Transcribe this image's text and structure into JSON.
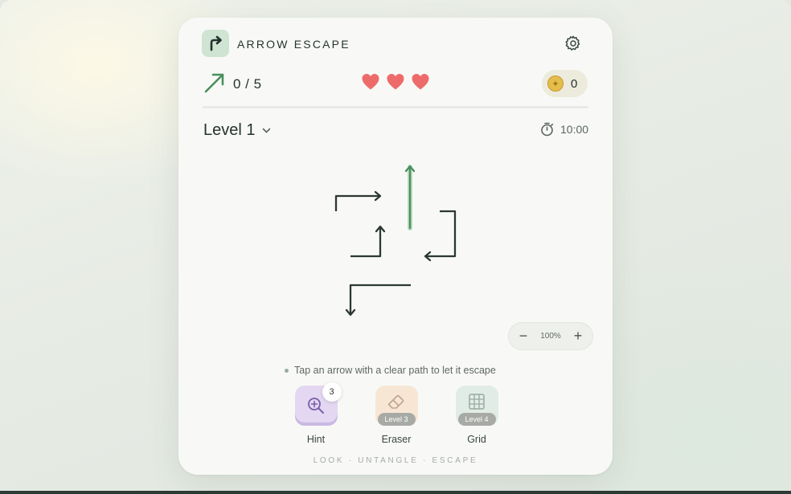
{
  "app": {
    "title": "ARROW ESCAPE"
  },
  "stats": {
    "progress": "0 / 5",
    "lives": 3,
    "coins": "0"
  },
  "level": {
    "label": "Level 1",
    "timer": "10:00"
  },
  "zoom": {
    "level": "100%",
    "minus": "−",
    "plus": "+"
  },
  "hint_text": "Tap an arrow with a clear path to let it escape",
  "tools": {
    "hint": {
      "label": "Hint",
      "count": "3"
    },
    "eraser": {
      "label": "Eraser",
      "lock": "Level 3"
    },
    "grid": {
      "label": "Grid",
      "lock": "Level 4"
    }
  },
  "footer": {
    "tagline": "LOOK · UNTANGLE · ESCAPE"
  },
  "colors": {
    "accent_green": "#4a8f5e",
    "heart_red": "#ee6b6b",
    "arrow_dark": "#2c3833",
    "coin_gold": "#e5bd4c"
  },
  "icons": [
    "turn-right-arrow-logo-icon",
    "gear-icon",
    "trend-arrow-icon",
    "heart-icon",
    "coin-icon",
    "chevron-down-icon",
    "stopwatch-icon",
    "magnifier-plus-icon",
    "eraser-icon",
    "grid-icon"
  ]
}
